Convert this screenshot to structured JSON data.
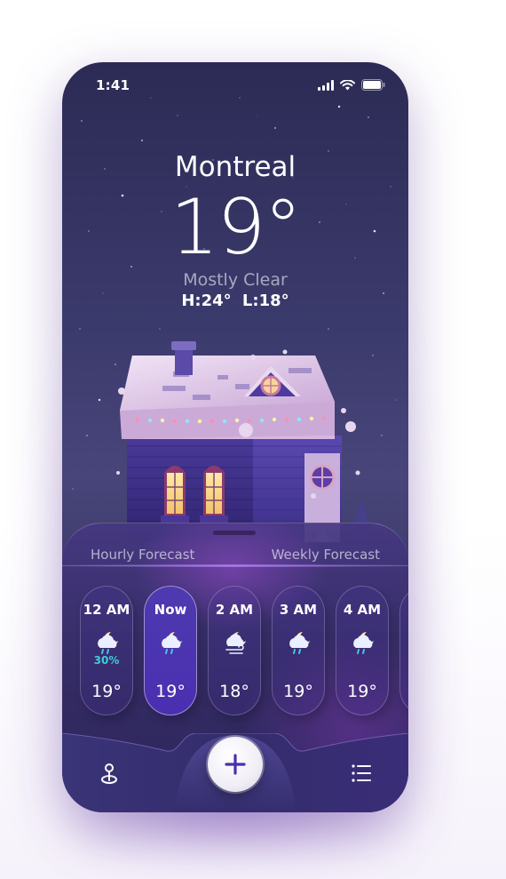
{
  "status_bar": {
    "time": "1:41"
  },
  "header": {
    "location": "Montreal",
    "temperature": "19°",
    "condition": "Mostly Clear",
    "high_low": "H:24°  L:18°"
  },
  "tabs": {
    "hourly": "Hourly Forecast",
    "weekly": "Weekly Forecast"
  },
  "hourly_forecast": [
    {
      "time": "12 AM",
      "icon": "cloud-moon-rain-icon",
      "precip": "30%",
      "temp": "19°",
      "active": false
    },
    {
      "time": "Now",
      "icon": "cloud-moon-rain-icon",
      "precip": "",
      "temp": "19°",
      "active": true
    },
    {
      "time": "2 AM",
      "icon": "cloud-moon-wind-icon",
      "precip": "",
      "temp": "18°",
      "active": false
    },
    {
      "time": "3 AM",
      "icon": "cloud-moon-rain-icon",
      "precip": "",
      "temp": "19°",
      "active": false
    },
    {
      "time": "4 AM",
      "icon": "cloud-moon-rain-icon",
      "precip": "",
      "temp": "19°",
      "active": false
    }
  ],
  "tab_bar": {
    "left_icon": "map-pin-icon",
    "center_icon": "plus-icon",
    "right_icon": "list-icon"
  },
  "colors": {
    "background_top": "#2c2b55",
    "sheet": "#2e265c",
    "active_card": "#4a2fb0",
    "precip_text": "#40cbd8",
    "add_button_plus": "#4a2fb0"
  }
}
